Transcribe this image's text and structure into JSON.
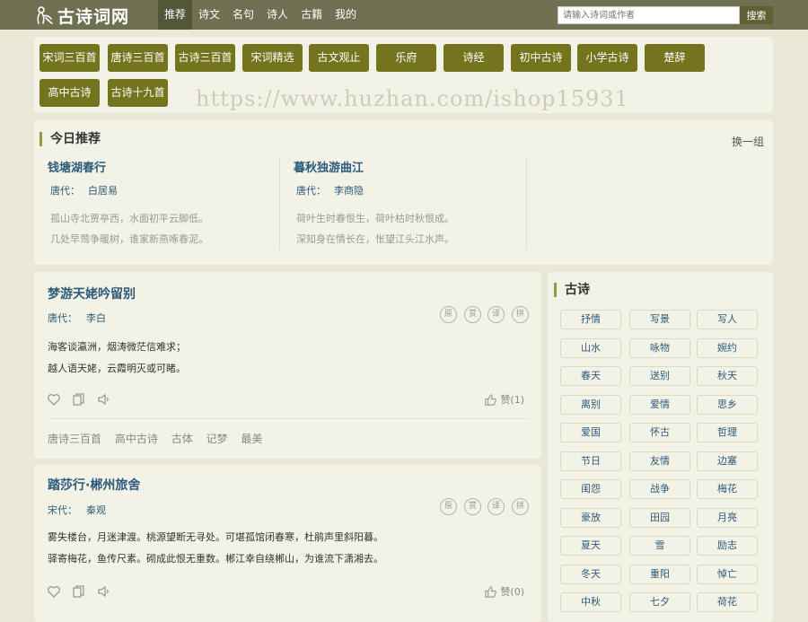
{
  "header": {
    "logo_text": "古诗词网",
    "nav": [
      "推荐",
      "诗文",
      "名句",
      "诗人",
      "古籍",
      "我的"
    ],
    "search_placeholder": "请输入诗词或作者",
    "search_button": "搜索"
  },
  "categories": [
    "宋词三百首",
    "唐诗三百首",
    "古诗三百首",
    "宋词精选",
    "古文观止",
    "乐府",
    "诗经",
    "初中古诗",
    "小学古诗",
    "楚辞",
    "高中古诗",
    "古诗十九首"
  ],
  "watermark": "https://www.huzhan.com/ishop15931",
  "today": {
    "title": "今日推荐",
    "switch_label": "换一组",
    "poems": [
      {
        "title": "钱塘湖春行",
        "dynasty": "唐代：",
        "author": "白居易",
        "lines": [
          "孤山寺北贾亭西，水面初平云脚低。",
          "几处早莺争暖树，谁家新燕啄春泥。"
        ]
      },
      {
        "title": "暮秋独游曲江",
        "dynasty": "唐代：",
        "author": "李商隐",
        "lines": [
          "荷叶生时春恨生，荷叶枯时秋恨成。",
          "深知身在情长在，怅望江头江水声。"
        ]
      }
    ]
  },
  "cards": [
    {
      "title": "梦游天姥吟留别",
      "dynasty": "唐代：",
      "author": "李白",
      "lines": [
        "海客谈瀛洲，烟涛微茫信难求；",
        "越人语天姥，云霞明灭或可睹。"
      ],
      "likes": "赞(1)",
      "tags": [
        "唐诗三百首",
        "高中古诗",
        "古体",
        "记梦",
        "最美"
      ]
    },
    {
      "title": "踏莎行·郴州旅舍",
      "dynasty": "宋代：",
      "author": "秦观",
      "lines": [
        "雾失楼台，月迷津渡。桃源望断无寻处。可堪孤馆闭春寒，杜鹃声里斜阳暮。",
        "驿寄梅花，鱼传尺素。砌成此恨无重数。郴江幸自绕郴山，为谁流下潇湘去。"
      ],
      "likes": "赞(0)",
      "tags": []
    }
  ],
  "card_actions": [
    "原",
    "赏",
    "译",
    "拼"
  ],
  "sidebar": {
    "title": "古诗",
    "tags": [
      "抒情",
      "写景",
      "写人",
      "山水",
      "咏物",
      "婉约",
      "春天",
      "送别",
      "秋天",
      "离别",
      "爱情",
      "思乡",
      "爱国",
      "怀古",
      "哲理",
      "节日",
      "友情",
      "边塞",
      "闺怨",
      "战争",
      "梅花",
      "豪放",
      "田园",
      "月亮",
      "夏天",
      "雪",
      "励志",
      "冬天",
      "重阳",
      "悼亡",
      "中秋",
      "七夕",
      "荷花"
    ]
  },
  "colors": {
    "topbar": "#6e7051",
    "tag_button": "#75741e",
    "link_blue": "#2e5b7a",
    "accent": "#8f9a3e"
  }
}
